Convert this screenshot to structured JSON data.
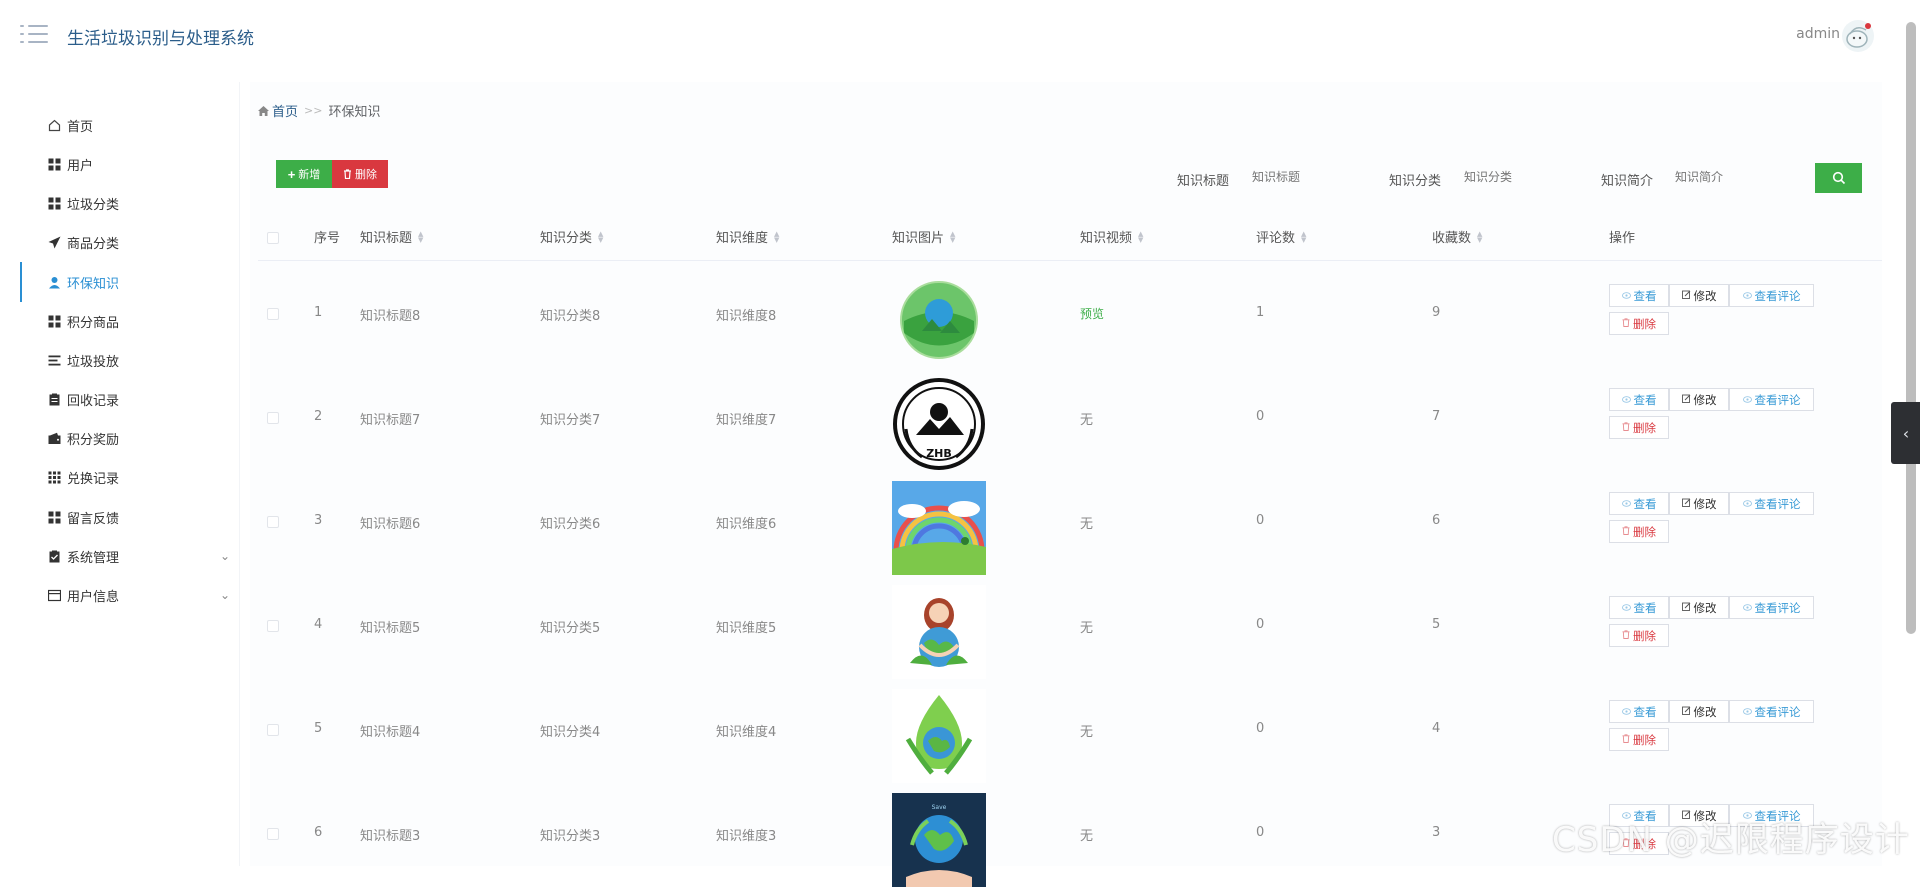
{
  "header": {
    "title": "生活垃圾识别与处理系统",
    "username": "admin"
  },
  "sidebar": {
    "items": [
      {
        "label": "首页",
        "icon": "home-icon"
      },
      {
        "label": "用户",
        "icon": "grid-icon"
      },
      {
        "label": "垃圾分类",
        "icon": "grid-icon"
      },
      {
        "label": "商品分类",
        "icon": "paper-plane-icon"
      },
      {
        "label": "环保知识",
        "icon": "user-icon",
        "active": true
      },
      {
        "label": "积分商品",
        "icon": "grid-icon"
      },
      {
        "label": "垃圾投放",
        "icon": "list-icon"
      },
      {
        "label": "回收记录",
        "icon": "clipboard-icon"
      },
      {
        "label": "积分奖励",
        "icon": "wallet-icon"
      },
      {
        "label": "兑换记录",
        "icon": "apps-icon"
      },
      {
        "label": "留言反馈",
        "icon": "grid-icon"
      },
      {
        "label": "系统管理",
        "icon": "clipboard-check-icon",
        "expandable": true
      },
      {
        "label": "用户信息",
        "icon": "card-icon",
        "expandable": true
      }
    ]
  },
  "breadcrumb": {
    "home": "首页",
    "separator": ">>",
    "current": "环保知识"
  },
  "toolbar": {
    "add_label": "新增",
    "delete_label": "删除"
  },
  "filters": [
    {
      "label": "知识标题",
      "placeholder": "知识标题"
    },
    {
      "label": "知识分类",
      "placeholder": "知识分类"
    },
    {
      "label": "知识简介",
      "placeholder": "知识简介"
    }
  ],
  "table": {
    "columns": [
      "序号",
      "知识标题",
      "知识分类",
      "知识维度",
      "知识图片",
      "知识视频",
      "评论数",
      "收藏数",
      "操作"
    ],
    "rows": [
      {
        "index": "1",
        "title": "知识标题8",
        "category": "知识分类8",
        "dimension": "知识维度8",
        "video": "预览",
        "comments": "1",
        "favorites": "9",
        "image": "earth-globe-icon"
      },
      {
        "index": "2",
        "title": "知识标题7",
        "category": "知识分类7",
        "dimension": "知识维度7",
        "video": "无",
        "comments": "0",
        "favorites": "7",
        "image": "zhb-emblem-icon"
      },
      {
        "index": "3",
        "title": "知识标题6",
        "category": "知识分类6",
        "dimension": "知识维度6",
        "video": "无",
        "comments": "0",
        "favorites": "6",
        "image": "rainbow-field-icon"
      },
      {
        "index": "4",
        "title": "知识标题5",
        "category": "知识分类5",
        "dimension": "知识维度5",
        "video": "无",
        "comments": "0",
        "favorites": "5",
        "image": "girl-hug-earth-icon"
      },
      {
        "index": "5",
        "title": "知识标题4",
        "category": "知识分类4",
        "dimension": "知识维度4",
        "video": "无",
        "comments": "0",
        "favorites": "4",
        "image": "leaf-drop-earth-icon"
      },
      {
        "index": "6",
        "title": "知识标题3",
        "category": "知识分类3",
        "dimension": "知识维度3",
        "video": "无",
        "comments": "0",
        "favorites": "3",
        "image": "hand-earth-icon"
      }
    ],
    "actions": {
      "view": "查看",
      "edit": "修改",
      "view_comments": "查看评论",
      "delete": "删除"
    }
  },
  "watermark": "CSDN @迟限程序设计"
}
